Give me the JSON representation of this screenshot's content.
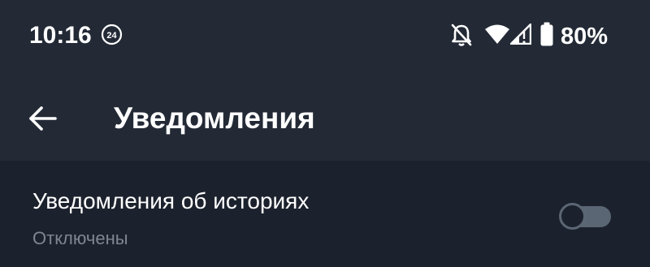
{
  "status_bar": {
    "time": "10:16",
    "badge": "24",
    "battery": "80%",
    "icons": [
      "notifications-off-icon",
      "wifi-icon",
      "signal-icon",
      "battery-icon"
    ]
  },
  "app_bar": {
    "title": "Уведомления",
    "back_icon": "arrow-left-icon"
  },
  "settings": [
    {
      "title": "Уведомления об историях",
      "subtitle": "Отключены",
      "enabled": false
    }
  ],
  "colors": {
    "header_bg": "#232a36",
    "content_bg": "#1c222d",
    "text_primary": "#ffffff",
    "text_secondary": "#7f8691",
    "toggle_off": "#5a6673"
  }
}
